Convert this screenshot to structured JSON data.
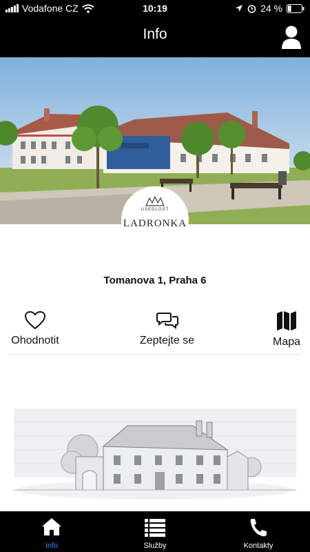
{
  "status_bar": {
    "carrier": "Vodafone CZ",
    "time": "10:19",
    "battery": "24 %",
    "battery_level": 0.24
  },
  "nav": {
    "title": "Info",
    "profile_icon": "user-icon"
  },
  "hero": {
    "logo_small_text": "USEDLOST",
    "logo_name": "LADRONKA",
    "icons": [
      "hero-photo",
      "logo-crown-icon"
    ]
  },
  "address": "Tomanova 1, Praha 6",
  "actions": [
    {
      "label": "Ohodnotit",
      "icon": "heart-icon"
    },
    {
      "label": "Zeptejte se",
      "icon": "chat-bubbles-icon"
    },
    {
      "label": "Mapa",
      "icon": "map-icon"
    }
  ],
  "tabs": [
    {
      "label": "Info",
      "icon": "home-icon",
      "active": true
    },
    {
      "label": "Služby",
      "icon": "list-icon",
      "active": false
    },
    {
      "label": "Kontakty",
      "icon": "phone-icon",
      "active": false
    }
  ],
  "colors": {
    "bar_background": "#000000",
    "active_tab": "#3b82f6",
    "page_background": "#ffffff"
  }
}
